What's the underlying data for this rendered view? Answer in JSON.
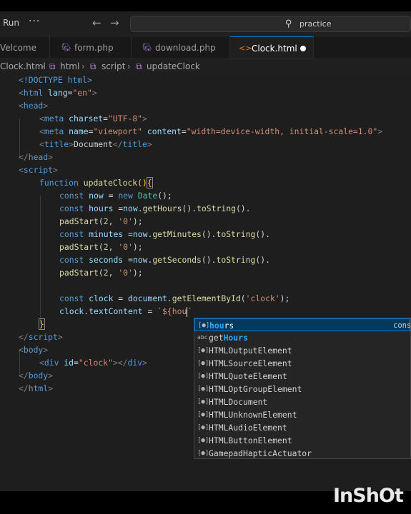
{
  "topbar": {
    "run_label": "Run",
    "more_label": "···",
    "back_arrow": "←",
    "forward_arrow": "→",
    "search_text": "practice",
    "search_icon": "search-icon"
  },
  "tabs": [
    {
      "icon": "",
      "label": "Velcome"
    },
    {
      "icon": "php-file-icon",
      "label": "form.php"
    },
    {
      "icon": "php-file-icon",
      "label": "download.php"
    },
    {
      "icon": "html-file-icon",
      "label": "Clock.html",
      "active": true,
      "dirty": true
    }
  ],
  "breadcrumb": [
    "Clock.html",
    "html",
    "script",
    "updateClock"
  ],
  "code": {
    "l1": "<!DOCTYPE html>",
    "l2a": "<",
    "l2b": "html",
    "l2c": "lang",
    "l2d": "=",
    "l2e": "\"en\"",
    "l2f": ">",
    "l3a": "<",
    "l3b": "head",
    "l3c": ">",
    "l4a": "<",
    "l4b": "meta",
    "l4c": "charset",
    "l4d": "=",
    "l4e": "\"UTF-8\"",
    "l4f": ">",
    "l5a": "<",
    "l5b": "meta",
    "l5c": "name",
    "l5d": "=",
    "l5e": "\"viewport\"",
    "l5f": "content",
    "l5g": "=",
    "l5h": "\"width=device-width, initial-scale=1.0\"",
    "l5i": ">",
    "l6a": "<",
    "l6b": "title",
    "l6c": ">",
    "l6d": "Document",
    "l6e": "</",
    "l6f": "title",
    "l6g": ">",
    "l7a": "</",
    "l7b": "head",
    "l7c": ">",
    "l8a": "<",
    "l8b": "script",
    "l8c": ">",
    "l9a": "function",
    "l9b": "updateClock",
    "l9c": "()",
    "l9d": "{",
    "l10a": "const",
    "l10b": "now",
    "l10c": " = ",
    "l10d": "new",
    "l10e": "Date",
    "l10f": "();",
    "l11a": "const",
    "l11b": "hours",
    "l11c": " =",
    "l11d": "now",
    "l11e": ".",
    "l11f": "getHours",
    "l11g": "().",
    "l11h": "toString",
    "l11i": "().",
    "l12a": "padStart",
    "l12b": "(",
    "l12c": "2",
    "l12d": ", ",
    "l12e": "'0'",
    "l12f": ");",
    "l13a": "const",
    "l13b": "minutes",
    "l13c": " =",
    "l13d": "now",
    "l13e": ".",
    "l13f": "getMinutes",
    "l13g": "().",
    "l13h": "toString",
    "l13i": "().",
    "l14a": "padStart",
    "l14b": "(",
    "l14c": "2",
    "l14d": ", ",
    "l14e": "'0'",
    "l14f": ");",
    "l15a": "const",
    "l15b": "seconds",
    "l15c": " =",
    "l15d": "now",
    "l15e": ".",
    "l15f": "getSeconds",
    "l15g": "().",
    "l15h": "toString",
    "l15i": "().",
    "l16a": "padStart",
    "l16b": "(",
    "l16c": "2",
    "l16d": ", ",
    "l16e": "'0'",
    "l16f": ");",
    "l18a": "const",
    "l18b": "clock",
    "l18c": " = ",
    "l18d": "document",
    "l18e": ".",
    "l18f": "getElementById",
    "l18g": "(",
    "l18h": "'clock'",
    "l18i": ");",
    "l19a": "clock",
    "l19b": ".",
    "l19c": "textContent",
    "l19d": " = ",
    "l19e": "`${hou",
    "l19f": "`",
    "l20a": "}",
    "l21a": "</",
    "l21b": "script",
    "l21c": ">",
    "l22a": "<",
    "l22b": "body",
    "l22c": ">",
    "l23a": "<",
    "l23b": "div",
    "l23c": "id",
    "l23d": "=",
    "l23e": "\"clock\"",
    "l23f": "></",
    "l23g": "div",
    "l23h": ">",
    "l24a": "</",
    "l24b": "body",
    "l24c": ">",
    "l25a": "</",
    "l25b": "html",
    "l25c": ">"
  },
  "suggestions": {
    "items": [
      {
        "icon": "variable-icon",
        "match": "hou",
        "rest": "rs",
        "detail": "const",
        "selected": true
      },
      {
        "icon": "text-word-icon",
        "match": "",
        "pre": "get",
        "mid": "Hours",
        "rest": ""
      },
      {
        "label": "HTMLOutputElement"
      },
      {
        "label": "HTMLSourceElement"
      },
      {
        "label": "HTMLQuoteElement"
      },
      {
        "label": "HTMLOptGroupElement"
      },
      {
        "label": "HTMLDocument"
      },
      {
        "label": "HTMLUnknownElement"
      },
      {
        "label": "HTMLAudioElement"
      },
      {
        "label": "HTMLButtonElement"
      },
      {
        "label": "GamepadHapticActuator"
      }
    ]
  },
  "watermark": "InShOt",
  "colors": {
    "keyword": "#569cd6",
    "function": "#dcdcaa",
    "variable": "#9cdcfe",
    "string": "#ce9178",
    "number": "#b5cea8",
    "tab_active_border": "#0078d4"
  }
}
